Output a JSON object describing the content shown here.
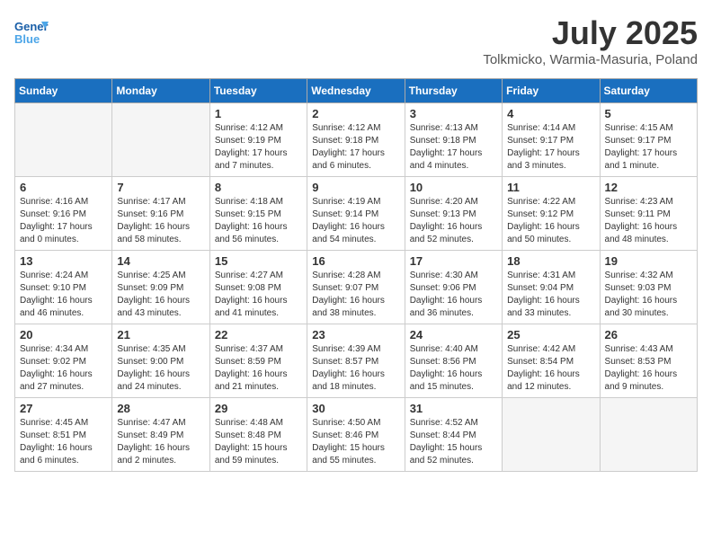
{
  "header": {
    "logo_general": "General",
    "logo_blue": "Blue",
    "month_title": "July 2025",
    "location": "Tolkmicko, Warmia-Masuria, Poland"
  },
  "days_of_week": [
    "Sunday",
    "Monday",
    "Tuesday",
    "Wednesday",
    "Thursday",
    "Friday",
    "Saturday"
  ],
  "weeks": [
    [
      {
        "day": "",
        "empty": true
      },
      {
        "day": "",
        "empty": true
      },
      {
        "day": "1",
        "sunrise": "4:12 AM",
        "sunset": "9:19 PM",
        "daylight": "17 hours and 7 minutes."
      },
      {
        "day": "2",
        "sunrise": "4:12 AM",
        "sunset": "9:18 PM",
        "daylight": "17 hours and 6 minutes."
      },
      {
        "day": "3",
        "sunrise": "4:13 AM",
        "sunset": "9:18 PM",
        "daylight": "17 hours and 4 minutes."
      },
      {
        "day": "4",
        "sunrise": "4:14 AM",
        "sunset": "9:17 PM",
        "daylight": "17 hours and 3 minutes."
      },
      {
        "day": "5",
        "sunrise": "4:15 AM",
        "sunset": "9:17 PM",
        "daylight": "17 hours and 1 minute."
      }
    ],
    [
      {
        "day": "6",
        "sunrise": "4:16 AM",
        "sunset": "9:16 PM",
        "daylight": "17 hours and 0 minutes."
      },
      {
        "day": "7",
        "sunrise": "4:17 AM",
        "sunset": "9:16 PM",
        "daylight": "16 hours and 58 minutes."
      },
      {
        "day": "8",
        "sunrise": "4:18 AM",
        "sunset": "9:15 PM",
        "daylight": "16 hours and 56 minutes."
      },
      {
        "day": "9",
        "sunrise": "4:19 AM",
        "sunset": "9:14 PM",
        "daylight": "16 hours and 54 minutes."
      },
      {
        "day": "10",
        "sunrise": "4:20 AM",
        "sunset": "9:13 PM",
        "daylight": "16 hours and 52 minutes."
      },
      {
        "day": "11",
        "sunrise": "4:22 AM",
        "sunset": "9:12 PM",
        "daylight": "16 hours and 50 minutes."
      },
      {
        "day": "12",
        "sunrise": "4:23 AM",
        "sunset": "9:11 PM",
        "daylight": "16 hours and 48 minutes."
      }
    ],
    [
      {
        "day": "13",
        "sunrise": "4:24 AM",
        "sunset": "9:10 PM",
        "daylight": "16 hours and 46 minutes."
      },
      {
        "day": "14",
        "sunrise": "4:25 AM",
        "sunset": "9:09 PM",
        "daylight": "16 hours and 43 minutes."
      },
      {
        "day": "15",
        "sunrise": "4:27 AM",
        "sunset": "9:08 PM",
        "daylight": "16 hours and 41 minutes."
      },
      {
        "day": "16",
        "sunrise": "4:28 AM",
        "sunset": "9:07 PM",
        "daylight": "16 hours and 38 minutes."
      },
      {
        "day": "17",
        "sunrise": "4:30 AM",
        "sunset": "9:06 PM",
        "daylight": "16 hours and 36 minutes."
      },
      {
        "day": "18",
        "sunrise": "4:31 AM",
        "sunset": "9:04 PM",
        "daylight": "16 hours and 33 minutes."
      },
      {
        "day": "19",
        "sunrise": "4:32 AM",
        "sunset": "9:03 PM",
        "daylight": "16 hours and 30 minutes."
      }
    ],
    [
      {
        "day": "20",
        "sunrise": "4:34 AM",
        "sunset": "9:02 PM",
        "daylight": "16 hours and 27 minutes."
      },
      {
        "day": "21",
        "sunrise": "4:35 AM",
        "sunset": "9:00 PM",
        "daylight": "16 hours and 24 minutes."
      },
      {
        "day": "22",
        "sunrise": "4:37 AM",
        "sunset": "8:59 PM",
        "daylight": "16 hours and 21 minutes."
      },
      {
        "day": "23",
        "sunrise": "4:39 AM",
        "sunset": "8:57 PM",
        "daylight": "16 hours and 18 minutes."
      },
      {
        "day": "24",
        "sunrise": "4:40 AM",
        "sunset": "8:56 PM",
        "daylight": "16 hours and 15 minutes."
      },
      {
        "day": "25",
        "sunrise": "4:42 AM",
        "sunset": "8:54 PM",
        "daylight": "16 hours and 12 minutes."
      },
      {
        "day": "26",
        "sunrise": "4:43 AM",
        "sunset": "8:53 PM",
        "daylight": "16 hours and 9 minutes."
      }
    ],
    [
      {
        "day": "27",
        "sunrise": "4:45 AM",
        "sunset": "8:51 PM",
        "daylight": "16 hours and 6 minutes."
      },
      {
        "day": "28",
        "sunrise": "4:47 AM",
        "sunset": "8:49 PM",
        "daylight": "16 hours and 2 minutes."
      },
      {
        "day": "29",
        "sunrise": "4:48 AM",
        "sunset": "8:48 PM",
        "daylight": "15 hours and 59 minutes."
      },
      {
        "day": "30",
        "sunrise": "4:50 AM",
        "sunset": "8:46 PM",
        "daylight": "15 hours and 55 minutes."
      },
      {
        "day": "31",
        "sunrise": "4:52 AM",
        "sunset": "8:44 PM",
        "daylight": "15 hours and 52 minutes."
      },
      {
        "day": "",
        "empty": true
      },
      {
        "day": "",
        "empty": true
      }
    ]
  ]
}
